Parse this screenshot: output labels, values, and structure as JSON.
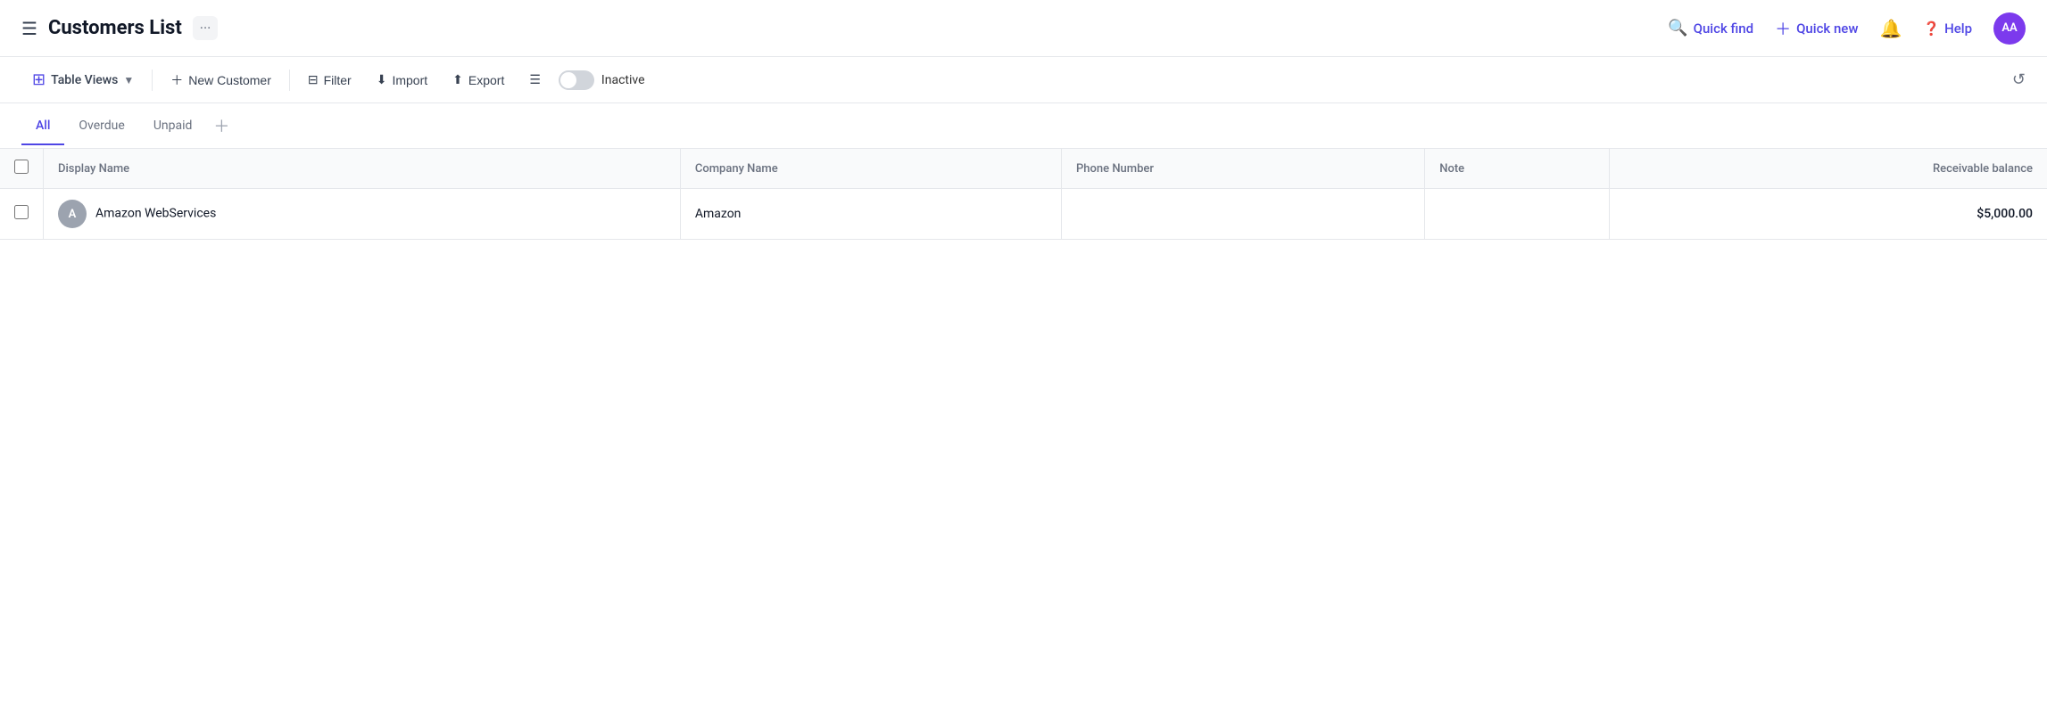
{
  "header": {
    "title": "Customers List",
    "more_icon": "···",
    "quick_find_label": "Quick find",
    "quick_new_label": "Quick new",
    "help_label": "Help",
    "avatar_initials": "AA"
  },
  "toolbar": {
    "table_views_label": "Table Views",
    "new_customer_label": "New Customer",
    "filter_label": "Filter",
    "import_label": "Import",
    "export_label": "Export",
    "inactive_label": "Inactive"
  },
  "tabs": [
    {
      "id": "all",
      "label": "All",
      "active": true
    },
    {
      "id": "overdue",
      "label": "Overdue",
      "active": false
    },
    {
      "id": "unpaid",
      "label": "Unpaid",
      "active": false
    }
  ],
  "table": {
    "columns": [
      {
        "id": "check",
        "label": ""
      },
      {
        "id": "display_name",
        "label": "Display Name"
      },
      {
        "id": "company_name",
        "label": "Company Name"
      },
      {
        "id": "phone_number",
        "label": "Phone Number"
      },
      {
        "id": "note",
        "label": "Note"
      },
      {
        "id": "receivable_balance",
        "label": "Receivable balance"
      }
    ],
    "rows": [
      {
        "display_name": "Amazon WebServices",
        "avatar_initial": "A",
        "company_name": "Amazon",
        "phone_number": "",
        "note": "",
        "receivable_balance": "$5,000.00"
      }
    ]
  }
}
